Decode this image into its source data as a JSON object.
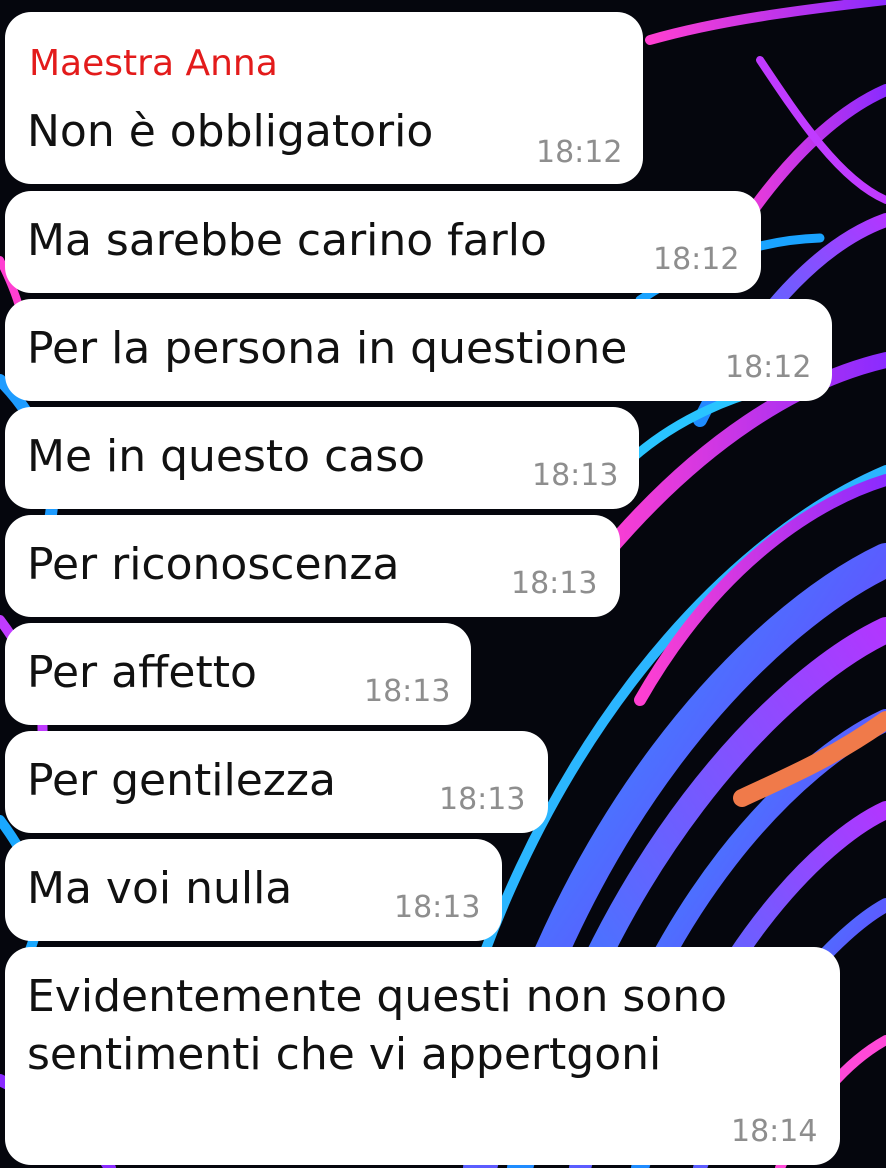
{
  "chat": {
    "sender_name": "Maestra Anna",
    "sender_color": "#e31b1b",
    "messages": [
      {
        "text": "Non è obbligatorio",
        "time": "18:12"
      },
      {
        "text": "Ma sarebbe carino farlo",
        "time": "18:12"
      },
      {
        "text": "Per la persona in questione",
        "time": "18:12"
      },
      {
        "text": "Me in questo caso",
        "time": "18:13"
      },
      {
        "text": "Per riconoscenza",
        "time": "18:13"
      },
      {
        "text": "Per affetto",
        "time": "18:13"
      },
      {
        "text": "Per gentilezza",
        "time": "18:13"
      },
      {
        "text": "Ma voi nulla",
        "time": "18:13"
      },
      {
        "text_line1": "Evidentemente questi non sono",
        "text_line2": "sentimenti che vi appertgoni",
        "time": "18:14"
      }
    ]
  },
  "colors": {
    "bubble": "#ffffff",
    "message_text": "#111111",
    "timestamp": "#8e8e8e",
    "background": "#05060d",
    "annotation_stroke": "#f07a4a"
  }
}
